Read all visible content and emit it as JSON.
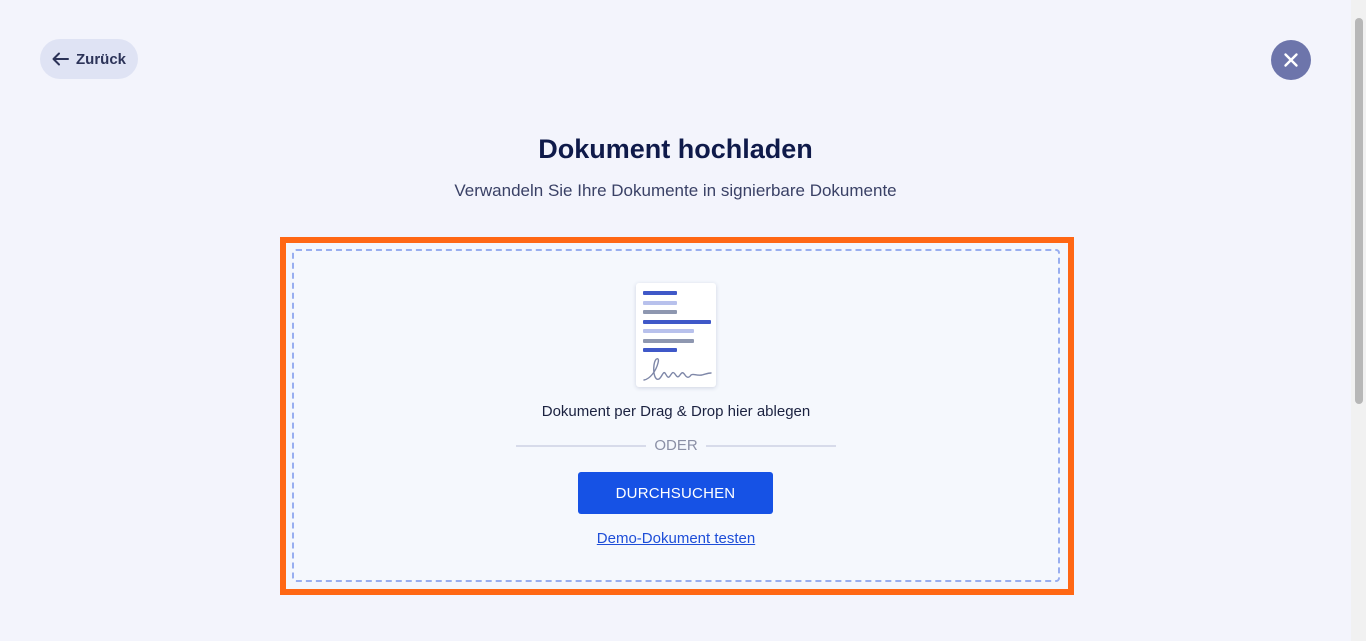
{
  "header": {
    "back_label": "Zurück"
  },
  "main": {
    "title": "Dokument hochladen",
    "subtitle": "Verwandeln Sie Ihre Dokumente in signierbare Dokumente"
  },
  "dropzone": {
    "drop_text": "Dokument per Drag & Drop hier ablegen",
    "divider_text": "ODER",
    "browse_label": "DURCHSUCHEN",
    "demo_link": "Demo-Dokument testen"
  },
  "colors": {
    "background": "#f3f4fc",
    "accent": "#1652e5",
    "highlight": "#ff6714",
    "close_button": "#6d75ab",
    "title": "#0f1a4a"
  },
  "icons": {
    "back": "arrow-left-icon",
    "close": "close-icon",
    "document": "document-signature-icon"
  }
}
